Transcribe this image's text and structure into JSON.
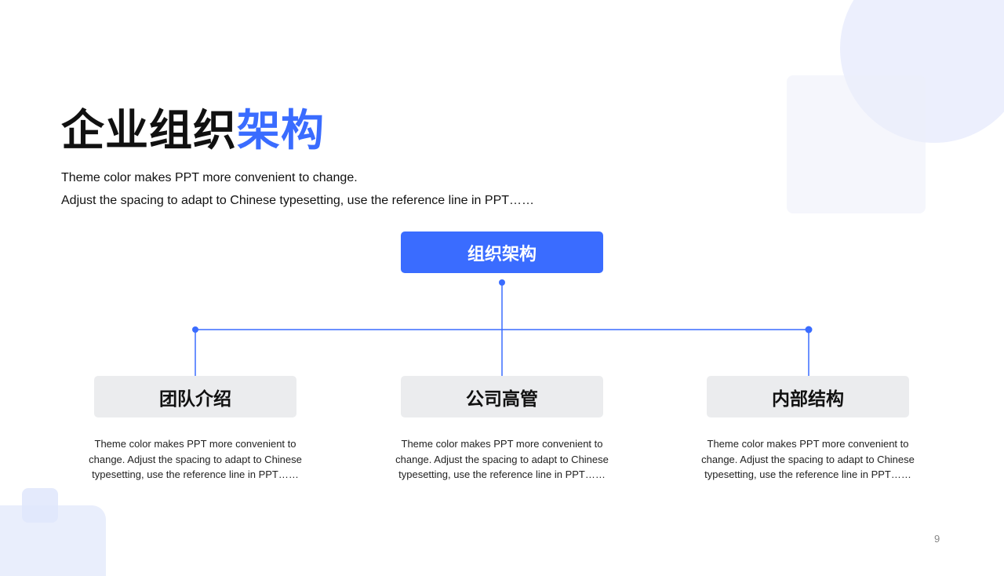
{
  "slide": {
    "title_main": "企业组织",
    "title_accent": "架构",
    "subtitle_lines": [
      "Theme color makes PPT more convenient to change.",
      "Adjust the spacing to adapt to Chinese typesetting, use the reference line in PPT……"
    ],
    "page_number": "9"
  },
  "org_chart": {
    "root": "组织架构",
    "children": [
      {
        "label": "团队介绍",
        "description": "Theme color makes PPT more convenient to change. Adjust the spacing to adapt to Chinese typesetting, use the reference line in PPT……"
      },
      {
        "label": "公司高管",
        "description": "Theme color makes PPT more convenient to change. Adjust the spacing to adapt to Chinese typesetting, use the reference line in PPT……"
      },
      {
        "label": "内部结构",
        "description": "Theme color makes PPT more convenient to change. Adjust the spacing to adapt to Chinese typesetting, use the reference line in PPT……"
      }
    ]
  },
  "colors": {
    "accent": "#3a6cff",
    "node_background": "#ebecee",
    "decor_light": "#eceffd"
  }
}
